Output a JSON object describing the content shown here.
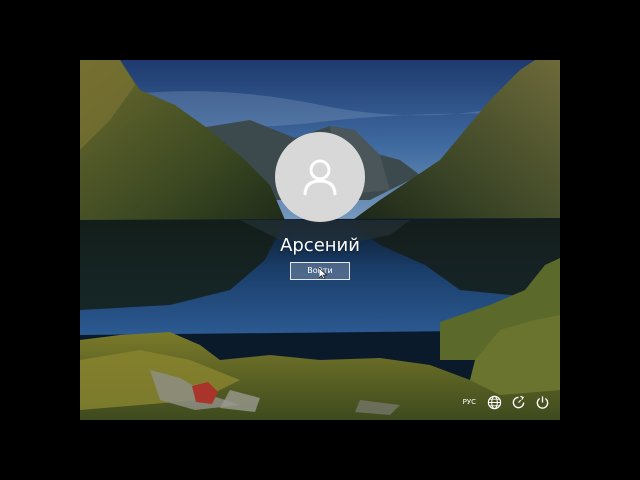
{
  "lock_screen": {
    "user_name": "Арсений",
    "signin_label": "Войти"
  },
  "tray": {
    "language": "РУС",
    "icons": [
      "network-icon",
      "ease-of-access-icon",
      "power-icon"
    ]
  },
  "colors": {
    "avatar_bg": "#d8d8d8",
    "avatar_glyph": "#ffffff",
    "text": "#ffffff"
  }
}
